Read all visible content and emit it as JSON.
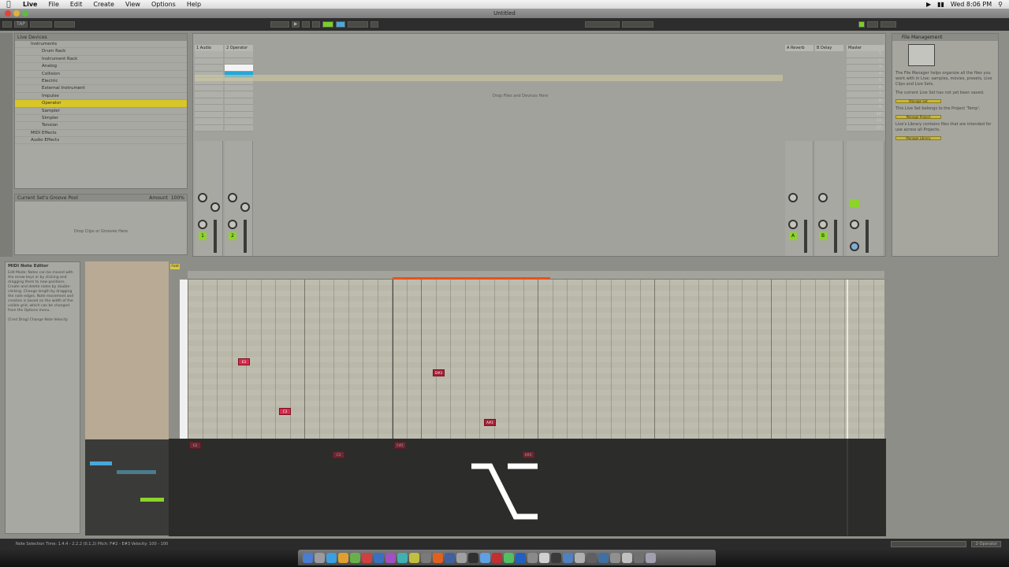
{
  "menubar": {
    "apple": "",
    "items": [
      "Live",
      "File",
      "Edit",
      "Create",
      "View",
      "Options",
      "Help"
    ],
    "clock": "Wed 8:06 PM"
  },
  "window": {
    "title": "Untitled"
  },
  "controlbar": {
    "tap": "TAP"
  },
  "browser": {
    "header": "Live Devices",
    "items": [
      {
        "label": "Instruments",
        "level": 0,
        "selected": false
      },
      {
        "label": "Drum Rack",
        "level": 1,
        "selected": false
      },
      {
        "label": "Instrument Rack",
        "level": 1,
        "selected": false
      },
      {
        "label": "Analog",
        "level": 1,
        "selected": false
      },
      {
        "label": "Collision",
        "level": 1,
        "selected": false
      },
      {
        "label": "Electric",
        "level": 1,
        "selected": false
      },
      {
        "label": "External Instrument",
        "level": 1,
        "selected": false
      },
      {
        "label": "Impulse",
        "level": 1,
        "selected": false
      },
      {
        "label": "Operator",
        "level": 1,
        "selected": true
      },
      {
        "label": "Sampler",
        "level": 1,
        "selected": false
      },
      {
        "label": "Simpler",
        "level": 1,
        "selected": false
      },
      {
        "label": "Tension",
        "level": 1,
        "selected": false
      },
      {
        "label": "MIDI Effects",
        "level": 0,
        "selected": false
      },
      {
        "label": "Audio Effects",
        "level": 0,
        "selected": false
      }
    ]
  },
  "groovepool": {
    "header": "Current Set's Groove Pool",
    "amount_label": "Amount",
    "amount_value": "100%",
    "drop_text": "Drop Clips or Grooves Here"
  },
  "session": {
    "tracks": [
      "1 Audio",
      "2 Operator"
    ],
    "returns": [
      "A Reverb",
      "B Delay"
    ],
    "master": "Master",
    "drop_text": "Drop Files and Devices Here",
    "scenes": [
      "1",
      "2",
      "3",
      "4",
      "5",
      "6",
      "7",
      "8",
      "9",
      "10",
      "11",
      "12"
    ],
    "track_buttons": [
      "1",
      "2"
    ],
    "return_buttons": [
      "A",
      "B"
    ],
    "stop_clips": "Stop Clips"
  },
  "filemanager": {
    "header": "File Management",
    "text1": "The File Manager helps organize all the files you work with in Live: samples, movies, presets, Live Clips and Live Sets.",
    "text2": "The current Live Set has not yet been saved.",
    "btn1": "Manage Set",
    "text3": "This Live Set belongs to the Project 'Temp'.",
    "btn2": "Manage Project",
    "text4": "Live's Library contains files that are intended for use across all Projects.",
    "btn3": "Manage Library"
  },
  "infoview": {
    "title": "MIDI Note Editor",
    "body": "Edit Mode: Notes can be moved with the arrow keys or by clicking and dragging them to new positions. Create and delete notes by double-clicking. Change length by dragging the note edges. Note movement and creation is based on the width of the visible grid, which can be changed from the Options menu.",
    "hint": "[Cmd Drag] Change Note Velocity"
  },
  "clipview": {
    "fold": "Fold",
    "notes": [
      {
        "label": "E3",
        "time": 1.2,
        "row": 14,
        "style": "bright"
      },
      {
        "label": "C3",
        "time": 2.0,
        "row": 23,
        "style": "bright"
      },
      {
        "label": "D#3",
        "time": 5.0,
        "row": 16,
        "style": "dark"
      },
      {
        "label": "A#2",
        "time": 6.0,
        "row": 25,
        "style": "dark"
      }
    ],
    "ghost_notes": [
      {
        "label": "G2",
        "time": 0.0
      },
      {
        "label": "C3",
        "time": 2.8
      },
      {
        "label": "F#2",
        "time": 4.0
      },
      {
        "label": "A#2",
        "time": 6.5
      }
    ]
  },
  "statusbar": {
    "left": "Note Selection  Time: 1.4.4 - 2.2.2 (0.1.2)  Pitch: F#2 - E#3  Velocity: 100 - 100",
    "right": "2-Operator"
  },
  "overlay": {
    "modifier_key": "option-key-icon"
  }
}
